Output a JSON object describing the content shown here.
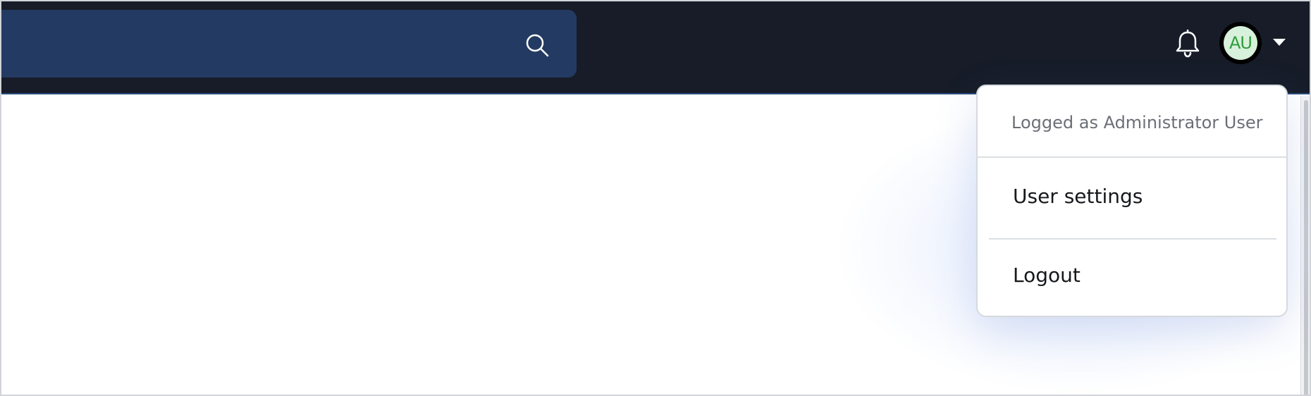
{
  "search": {
    "value": "",
    "placeholder": ""
  },
  "icons": {
    "search": "search-icon",
    "notifications": "bell-icon",
    "caret": "caret-down-icon"
  },
  "user": {
    "initials": "AU"
  },
  "user_menu": {
    "header": "Logged as Administrator User",
    "items": [
      {
        "label": "User settings"
      },
      {
        "label": "Logout"
      }
    ]
  },
  "colors": {
    "topbar": "#171c28",
    "search_bg": "#233a63",
    "avatar_bg": "#d8f1dc",
    "avatar_text": "#2e9e3c"
  }
}
